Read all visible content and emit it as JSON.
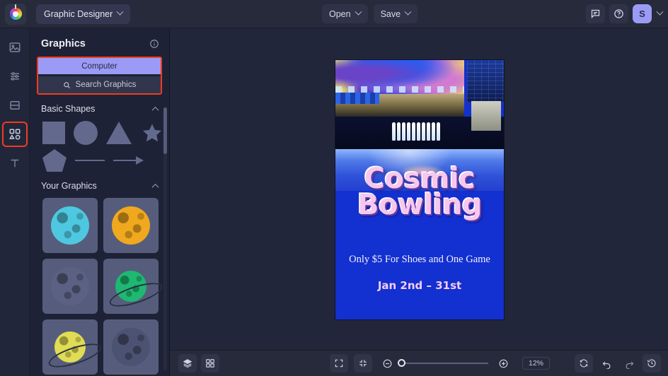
{
  "app": {
    "logo_icon": "color-wheel-logo",
    "workspace": "Graphic Designer",
    "menus": [
      {
        "label": "Open",
        "name": "open-menu"
      },
      {
        "label": "Save",
        "name": "save-menu"
      }
    ],
    "header_icons": [
      {
        "name": "feedback-icon"
      },
      {
        "name": "help-icon"
      }
    ],
    "avatar_initial": "S"
  },
  "rail": {
    "items": [
      {
        "name": "image-tools-icon",
        "label": "Image",
        "selected": false
      },
      {
        "name": "adjust-sliders-icon",
        "label": "Edit",
        "selected": false
      },
      {
        "name": "layout-icon",
        "label": "Layout",
        "selected": false
      },
      {
        "name": "graphics-shapes-icon",
        "label": "Graphics",
        "selected": true
      },
      {
        "name": "text-icon",
        "label": "Text",
        "selected": false
      }
    ]
  },
  "panel": {
    "title": "Graphics",
    "info_icon": "info-icon",
    "computer_tab": "Computer",
    "search_placeholder": "Search Graphics",
    "search_icon": "search-icon",
    "sections": [
      {
        "title": "Basic Shapes",
        "collapsed": false
      },
      {
        "title": "Your Graphics",
        "collapsed": false
      }
    ],
    "basic_shapes": [
      {
        "name": "shape-square"
      },
      {
        "name": "shape-circle"
      },
      {
        "name": "shape-triangle"
      },
      {
        "name": "shape-star"
      },
      {
        "name": "shape-pentagon"
      },
      {
        "name": "shape-line"
      },
      {
        "name": "shape-arrow"
      }
    ],
    "your_graphics": [
      {
        "name": "graphic-planet-cyan",
        "color": "#4ec8e0"
      },
      {
        "name": "graphic-planet-orange",
        "color": "#f0a81e"
      },
      {
        "name": "graphic-planet-gray",
        "color": "#5a6182"
      },
      {
        "name": "graphic-planet-green-ringed",
        "color": "#1eb872"
      },
      {
        "name": "graphic-planet-yellow-ringed",
        "color": "#e0dc54"
      },
      {
        "name": "graphic-planet-dark",
        "color": "#4b5272"
      }
    ]
  },
  "canvas": {
    "poster": {
      "title_line1": "Cosmic",
      "title_line2": "Bowling",
      "subtitle": "Only $5 For Shoes and One Game",
      "date": "Jan 2nd – 31st"
    }
  },
  "bottombar": {
    "left_buttons": [
      {
        "name": "layers-button",
        "icon": "layers-icon"
      },
      {
        "name": "grid-view-button",
        "icon": "grid-icon"
      }
    ],
    "fit_buttons": [
      {
        "name": "fit-to-screen-button",
        "icon": "expand-icon"
      },
      {
        "name": "actual-size-button",
        "icon": "collapse-icon"
      }
    ],
    "zoom_out_icon": "zoom-out-icon",
    "zoom_in_icon": "zoom-in-icon",
    "zoom_level": "12%",
    "right_buttons": [
      {
        "name": "reset-button",
        "icon": "refresh-icon"
      },
      {
        "name": "undo-button",
        "icon": "undo-icon"
      },
      {
        "name": "redo-button",
        "icon": "redo-icon"
      },
      {
        "name": "history-button",
        "icon": "history-icon"
      }
    ]
  },
  "colors": {
    "accent": "#9b9bf5",
    "highlight_outline": "#f03c1e",
    "panel_bg": "#1e2236",
    "poster_bg": "#1330d0"
  }
}
